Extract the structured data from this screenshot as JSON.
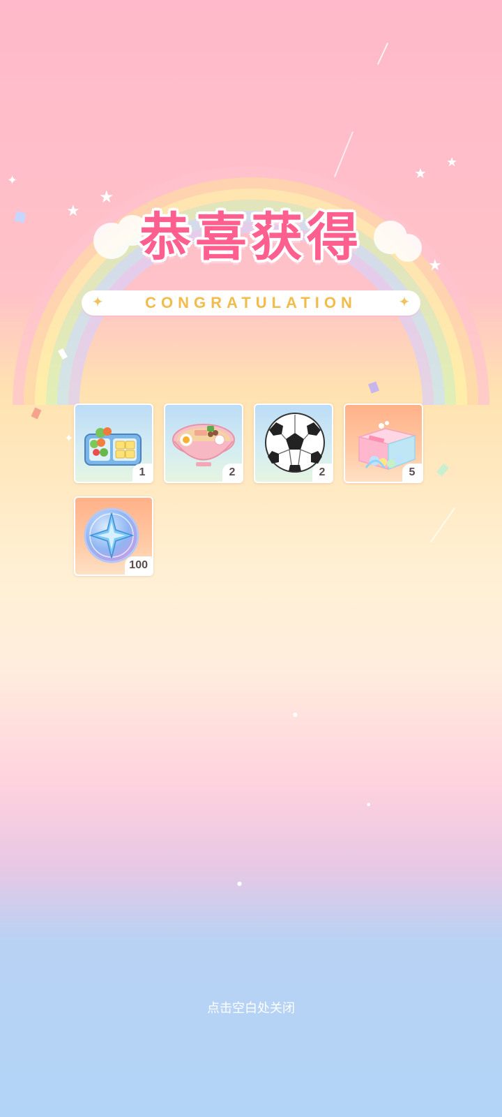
{
  "title": "恭喜获得",
  "subtitle": "CONGRATULATION",
  "rewards": [
    {
      "icon": "bento-box-icon",
      "quantity": "1",
      "bg": "blue"
    },
    {
      "icon": "ramen-bowl-icon",
      "quantity": "2",
      "bg": "blue"
    },
    {
      "icon": "soccer-ball-icon",
      "quantity": "2",
      "bg": "blue"
    },
    {
      "icon": "gift-box-icon",
      "quantity": "5",
      "bg": "orange"
    },
    {
      "icon": "star-coin-icon",
      "quantity": "100",
      "bg": "orange"
    }
  ],
  "close_hint": "点击空白处关闭",
  "colors": {
    "title": "#ff5f8e",
    "subtitle_text": "#f2bb4a",
    "bg_top": "#ffb9ca",
    "bg_bottom": "#b2d4f6"
  }
}
